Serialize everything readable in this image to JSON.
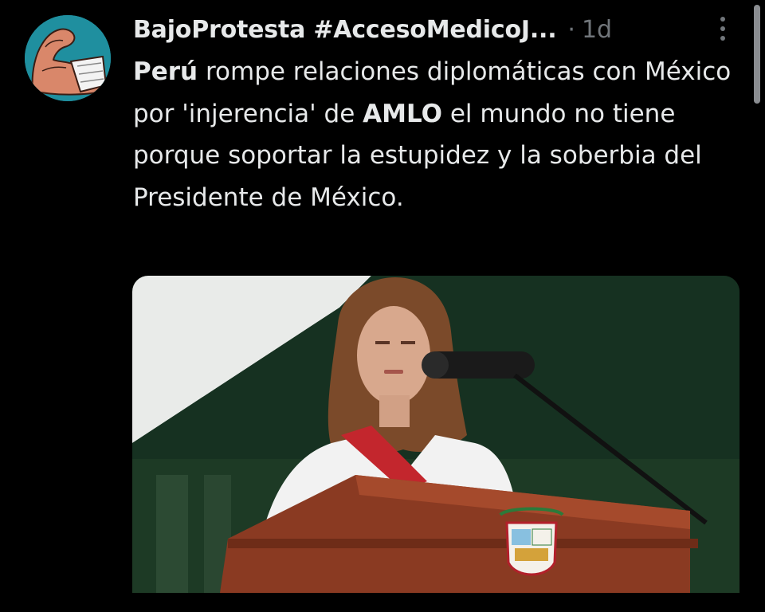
{
  "tweet": {
    "author_name": "BajoProtesta #AccesoMedicoJ...",
    "separator": "·",
    "time": "1d",
    "text_parts": [
      {
        "text": "Perú",
        "bold": true
      },
      {
        "text": " rompe relaciones diplomáticas con México por 'injerencia' de ",
        "bold": false
      },
      {
        "text": "AMLO",
        "bold": true
      },
      {
        "text": " el mundo no tiene porque soportar la estupidez y la soberbia del Presidente de México.",
        "bold": false
      }
    ]
  },
  "icons": {
    "more": "more-vertical-icon",
    "avatar": "flexed-arm-icon"
  },
  "colors": {
    "background": "#000000",
    "text": "#e7e9ea",
    "muted": "#71767b",
    "avatar_bg": "#1f8f9f"
  }
}
